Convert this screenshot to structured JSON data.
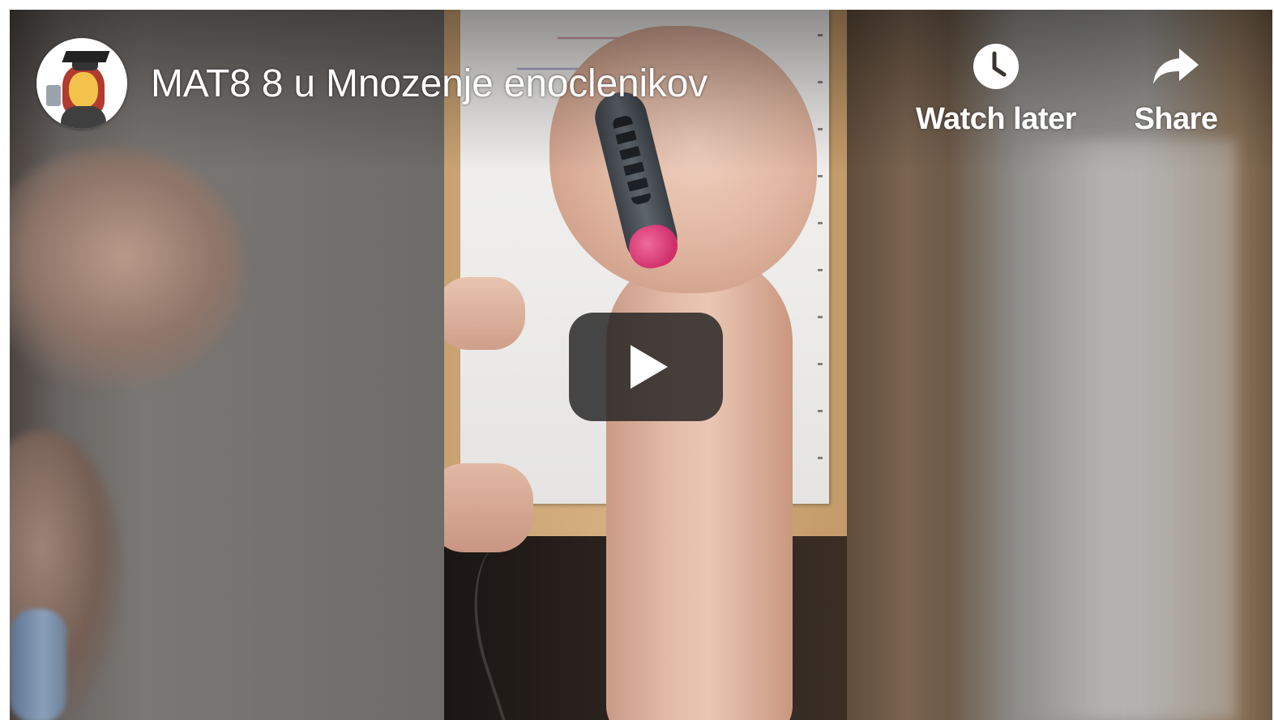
{
  "video": {
    "title": "MAT8 8 u Mnozenje enoclenikov"
  },
  "channel": {
    "avatar_icon": "graduate-girl-avatar"
  },
  "actions": {
    "watch_later_label": "Watch later",
    "watch_later_icon": "clock-icon",
    "share_label": "Share",
    "share_icon": "share-arrow-icon"
  },
  "player": {
    "play_icon": "play-icon"
  },
  "colors": {
    "overlay_text": "#ffffff",
    "play_button_bg": "#212121",
    "pen_cap": "#cf2f6b"
  }
}
